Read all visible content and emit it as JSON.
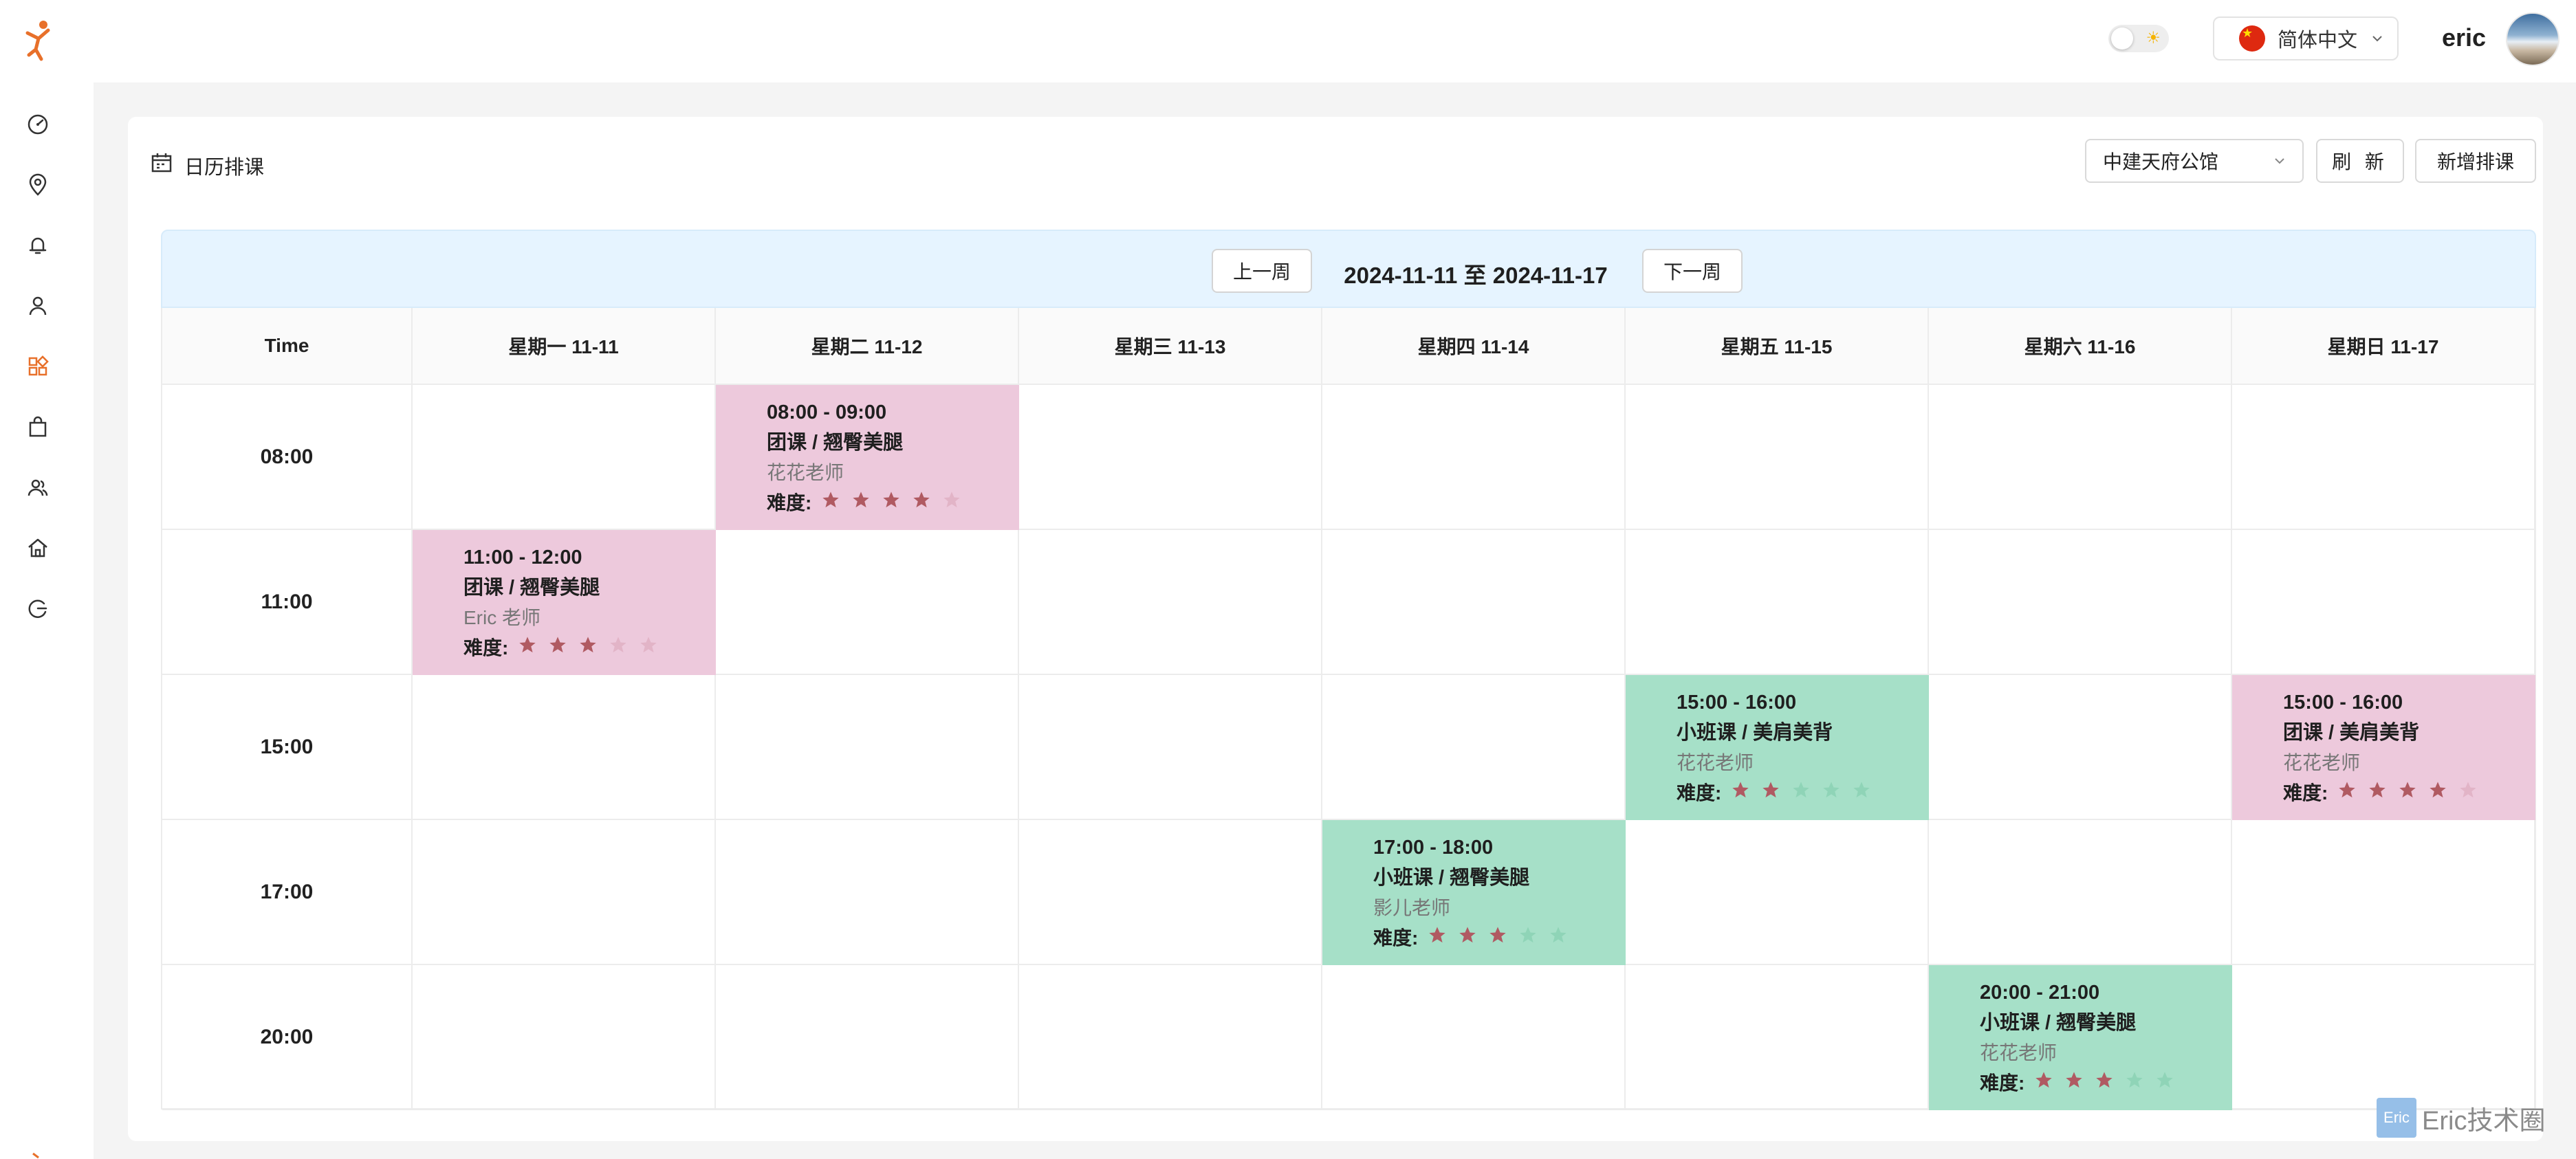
{
  "header": {
    "username": "eric",
    "language": {
      "label": "简体中文",
      "flag_color": "#de2910"
    },
    "theme_icon": "sun-icon"
  },
  "sidebar": {
    "items": [
      {
        "icon": "dashboard-icon"
      },
      {
        "icon": "location-pin-icon"
      },
      {
        "icon": "bell-icon"
      },
      {
        "icon": "user-icon"
      },
      {
        "icon": "apps-grid-icon",
        "active": true
      },
      {
        "icon": "shopping-bag-icon"
      },
      {
        "icon": "team-icon"
      },
      {
        "icon": "home-icon"
      },
      {
        "icon": "logout-icon"
      }
    ],
    "accent": "#e8702a"
  },
  "page": {
    "title": "日历排课",
    "studio": "中建天府公馆",
    "refresh_label": "刷 新",
    "add_label": "新增排课"
  },
  "week": {
    "prev_label": "上一周",
    "next_label": "下一周",
    "range": "2024-11-11 至 2024-11-17"
  },
  "calendar": {
    "time_header": "Time",
    "days": [
      "星期一 11-11",
      "星期二 11-12",
      "星期三 11-13",
      "星期四 11-14",
      "星期五 11-15",
      "星期六 11-16",
      "星期日 11-17"
    ],
    "slots": [
      "08:00",
      "11:00",
      "15:00",
      "17:00",
      "20:00"
    ],
    "difficulty_label": "难度:",
    "events": [
      {
        "day": 1,
        "slot": 0,
        "kind": "group",
        "time": "08:00 - 09:00",
        "title": "团课 / 翘臀美腿",
        "teacher": "花花老师",
        "difficulty": 4
      },
      {
        "day": 0,
        "slot": 1,
        "kind": "group",
        "time": "11:00 - 12:00",
        "title": "团课 / 翘臀美腿",
        "teacher": "Eric 老师",
        "difficulty": 3
      },
      {
        "day": 4,
        "slot": 2,
        "kind": "small",
        "time": "15:00 - 16:00",
        "title": "小班课 / 美肩美背",
        "teacher": "花花老师",
        "difficulty": 2
      },
      {
        "day": 6,
        "slot": 2,
        "kind": "group",
        "time": "15:00 - 16:00",
        "title": "团课 / 美肩美背",
        "teacher": "花花老师",
        "difficulty": 4
      },
      {
        "day": 3,
        "slot": 3,
        "kind": "small",
        "time": "17:00 - 18:00",
        "title": "小班课 / 翘臀美腿",
        "teacher": "影儿老师",
        "difficulty": 3
      },
      {
        "day": 5,
        "slot": 4,
        "kind": "small",
        "time": "20:00 - 21:00",
        "title": "小班课 / 翘臀美腿",
        "teacher": "花花老师",
        "difficulty": 3
      }
    ],
    "colors": {
      "group": "#edc9dc",
      "small": "#a6e0c8",
      "star_filled": "#b05a62",
      "star_empty_group": "#e2b4c7",
      "star_empty_small": "#8fd4b7"
    }
  },
  "watermark": {
    "badge": "Eric",
    "text": "Eric技术圈"
  }
}
